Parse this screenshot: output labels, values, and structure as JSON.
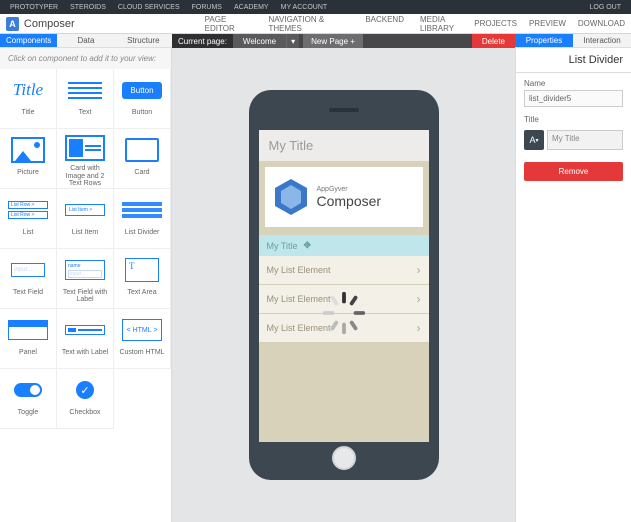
{
  "topnav": {
    "left": [
      "PROTOTYPER",
      "STEROIDS",
      "CLOUD SERVICES",
      "FORUMS",
      "ACADEMY",
      "MY ACCOUNT"
    ],
    "right": [
      "LOG OUT"
    ]
  },
  "header": {
    "brand": "Composer",
    "mid": [
      "PAGE EDITOR",
      "NAVIGATION & THEMES",
      "BACKEND",
      "MEDIA LIBRARY"
    ],
    "right": [
      "PROJECTS",
      "PREVIEW",
      "DOWNLOAD"
    ]
  },
  "left_tabs": [
    "Components",
    "Data",
    "Structure"
  ],
  "left_tabs_active": 0,
  "center_bar": {
    "label": "Current page:",
    "selected": "Welcome",
    "newpage": "New Page +",
    "delete": "Delete"
  },
  "right_tabs": [
    "Properties",
    "Interaction"
  ],
  "right_tabs_active": 0,
  "sidebar_hint": "Click on component to add it to your view:",
  "components": [
    {
      "label": "Title",
      "icon": "title"
    },
    {
      "label": "Text",
      "icon": "text"
    },
    {
      "label": "Button",
      "icon": "button"
    },
    {
      "label": "Picture",
      "icon": "picture"
    },
    {
      "label": "Card with Image and 2 Text Rows",
      "icon": "card2"
    },
    {
      "label": "Card",
      "icon": "card"
    },
    {
      "label": "List",
      "icon": "list"
    },
    {
      "label": "List Item",
      "icon": "listitem"
    },
    {
      "label": "List Divider",
      "icon": "divider"
    },
    {
      "label": "Text Field",
      "icon": "textfield"
    },
    {
      "label": "Text Field with Label",
      "icon": "textfieldlabel"
    },
    {
      "label": "Text Area",
      "icon": "textarea"
    },
    {
      "label": "Panel",
      "icon": "panel"
    },
    {
      "label": "Text with Label",
      "icon": "textwithlabel"
    },
    {
      "label": "Custom HTML",
      "icon": "html"
    },
    {
      "label": "Toggle",
      "icon": "toggle"
    },
    {
      "label": "Checkbox",
      "icon": "checkbox"
    }
  ],
  "phone": {
    "title": "My Title",
    "logo_top": "AppGyver",
    "logo_main": "Composer",
    "divider": "My Title",
    "items": [
      "My List Element",
      "My List Element",
      "My List Element"
    ]
  },
  "props": {
    "title": "List Divider",
    "name_label": "Name",
    "name_value": "list_divider5",
    "title_label": "Title",
    "title_value": "My Title",
    "remove": "Remove"
  },
  "icon_text": {
    "title": "Title",
    "button": "Button",
    "list_row": "List Row >",
    "list_item": "List Item   >",
    "input": "input...",
    "name": "name",
    "html": "< HTML >"
  }
}
